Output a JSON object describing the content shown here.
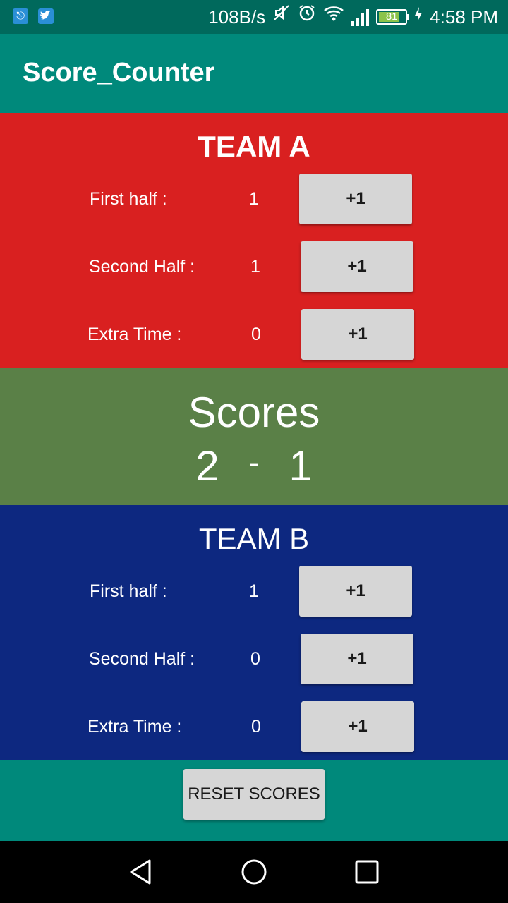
{
  "status_bar": {
    "left_icons": [
      "usb-icon",
      "twitter-icon"
    ],
    "net_speed": "108B/s",
    "icons": [
      "mute-icon",
      "alarm-icon",
      "wifi-icon",
      "signal-icon"
    ],
    "battery_level": "81",
    "time": "4:58 PM"
  },
  "app_bar": {
    "title": "Score_Counter"
  },
  "team_a": {
    "name": "TEAM A",
    "first_half_label": "First half :",
    "first_half_value": "1",
    "second_half_label": "Second Half :",
    "second_half_value": "1",
    "extra_time_label": "Extra Time :",
    "extra_time_value": "0",
    "button_label": "+1"
  },
  "scores": {
    "title": "Scores",
    "team_a_total": "2",
    "separator": "-",
    "team_b_total": "1"
  },
  "team_b": {
    "name": "TEAM B",
    "first_half_label": "First half :",
    "first_half_value": "1",
    "second_half_label": "Second Half :",
    "second_half_value": "0",
    "extra_time_label": "Extra Time :",
    "extra_time_value": "0",
    "button_label": "+1"
  },
  "reset_button": {
    "label": "RESET SCORES"
  },
  "nav_bar": {
    "icons": [
      "back-icon",
      "home-icon",
      "recents-icon"
    ]
  },
  "colors": {
    "app_bar": "#00897b",
    "status_bar": "#00695c",
    "team_a_bg": "#d92020",
    "scores_bg": "#5a8047",
    "team_b_bg": "#0d2880",
    "button_bg": "#d6d6d6"
  }
}
